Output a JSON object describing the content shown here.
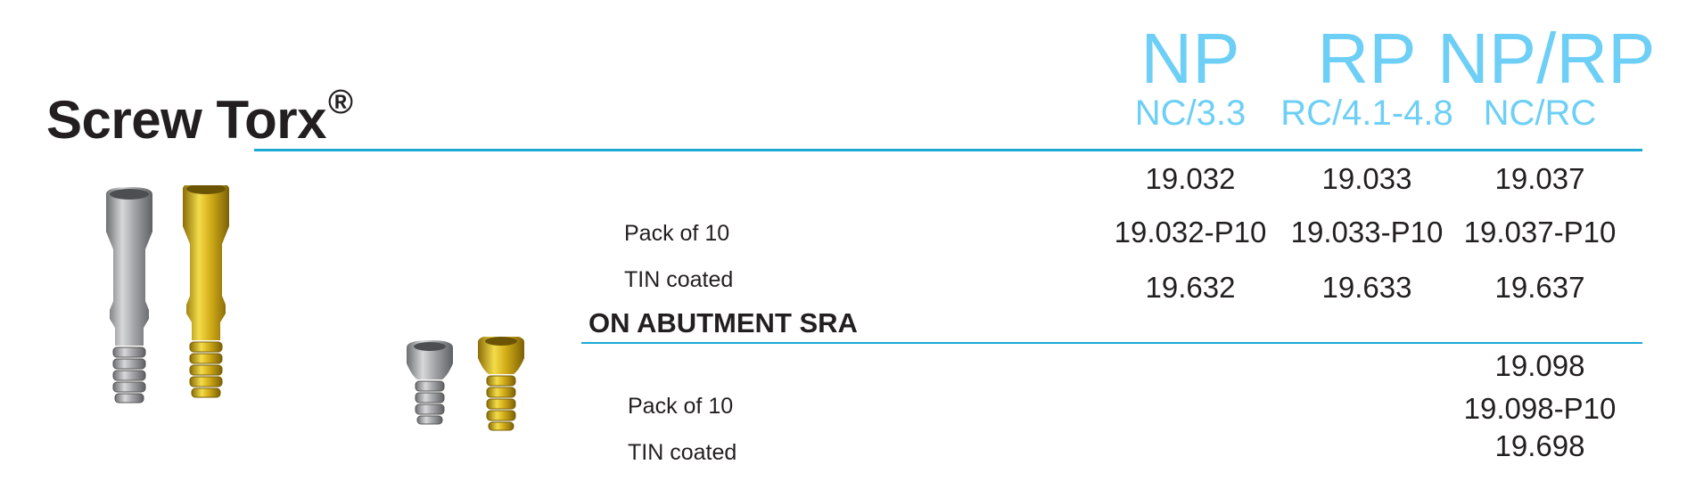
{
  "product": {
    "title": "Screw Torx",
    "trademark": "®"
  },
  "columns": [
    {
      "platform": "NP",
      "connection": "NC/3.3"
    },
    {
      "platform": "RP",
      "connection": "RC/4.1-4.8"
    },
    {
      "platform": "NP/RP",
      "connection": "NC/RC"
    }
  ],
  "main_table": {
    "rows": [
      {
        "label": "",
        "values": [
          "19.032",
          "19.033",
          "19.037"
        ]
      },
      {
        "label": "Pack of 10",
        "values": [
          "19.032-P10",
          "19.033-P10",
          "19.037-P10"
        ]
      },
      {
        "label": "TIN coated",
        "values": [
          "19.632",
          "19.633",
          "19.637"
        ]
      }
    ]
  },
  "abutment_section": {
    "heading": "ON ABUTMENT SRA",
    "rows": [
      {
        "label": "",
        "value": "19.098"
      },
      {
        "label": "Pack of 10",
        "value": "19.098-P10"
      },
      {
        "label": "TIN coated",
        "value": "19.698"
      }
    ]
  },
  "colors": {
    "accent": "#6dcff6",
    "rule": "#1ba9d6",
    "text": "#231f20",
    "screw_silver": "#a8a9ab",
    "screw_gold": "#d4b21c"
  }
}
